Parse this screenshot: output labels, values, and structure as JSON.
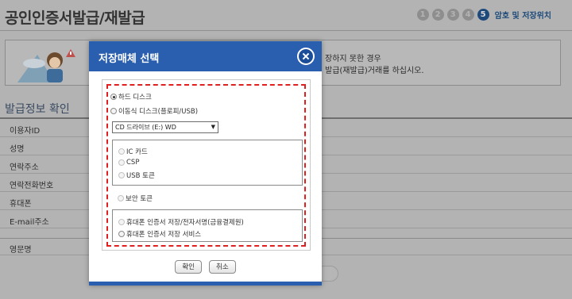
{
  "page": {
    "title": "공인인증서발급/재발급",
    "steps": [
      "1",
      "2",
      "3",
      "4",
      "5"
    ],
    "active_step_label": "암호 및 저장위치",
    "notice_line1": "할 수 없는 경우나, 인증서 발급/재발급 중 저장하지 못한 경우",
    "notice_line2": "인증서 발급/재발급에 실패한 경우는 인증서 발급(재발급)거래를 하십시오.",
    "notice_visible1": "장하지 못한 경우",
    "notice_visible2": "발급(재발급)거래를 하십시오.",
    "section_title": "발급정보 확인",
    "info_rows": [
      "이용자ID",
      "성명",
      "연락주소",
      "연락전화번호",
      "휴대폰",
      "E-mail주소",
      "영문명"
    ]
  },
  "modal": {
    "title": "저장매체 선택",
    "options": {
      "hard_disk": "하드 디스크",
      "removable_disk": "이동식 디스크(플로피/USB)",
      "drive_select_value": "CD 드라이브 (E:) WD",
      "ic_card": "IC 카드",
      "csp": "CSP",
      "usb_token": "USB 토큰",
      "security_token": "보안 토큰",
      "phone_cert_storage": "휴대폰 인증서 저장/전자서명(금융결제원)",
      "phone_cert_service": "휴대폰 인증서 저장 서비스"
    },
    "confirm_label": "확인",
    "cancel_label": "취소"
  },
  "colors": {
    "header_blue": "#2a5fb0",
    "dashed_red": "#e02020",
    "active_step": "#1d4a7a"
  }
}
